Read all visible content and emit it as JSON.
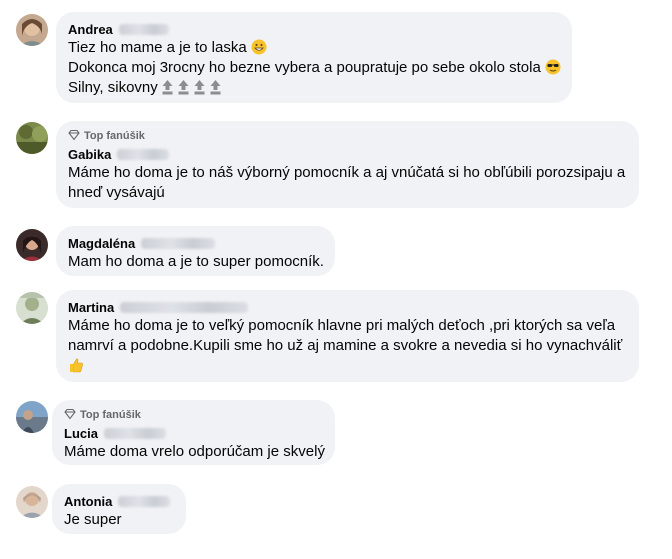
{
  "comments": [
    {
      "author": "Andrea",
      "badge": "",
      "lines": [
        "Tiez ho mame a je to laska",
        "Dokonca moj 3rocny ho bezne vybera a poupratuje po sebe okolo stola",
        "Silny, sikovny"
      ],
      "emojis": [
        "grinning-face-icon",
        "sunglasses-face-icon",
        "top-arrow-icon x4"
      ]
    },
    {
      "author": "Gabika",
      "badge": "Top fanúšik",
      "lines": [
        "Máme ho doma je to náš výborný pomocník a aj vnúčatá si ho obľúbili porozsipaju a",
        "hneď vysávajú"
      ]
    },
    {
      "author": "Magdaléna",
      "badge": "",
      "lines": [
        "Mam ho doma a je to super pomocník."
      ]
    },
    {
      "author": "Martina",
      "badge": "",
      "lines": [
        "Máme ho doma je to veľký pomocník hlavne pri malých deťoch ,pri ktorých sa veľa",
        "namrví a podobne.Kupili sme ho už aj mamine a svokre a nevedia si ho vynachváliť"
      ],
      "emojis": [
        "thumbs-up-icon"
      ]
    },
    {
      "author": "Lucia",
      "badge": "Top fanúšik",
      "lines": [
        "Máme doma vrelo odporúčam je skvelý"
      ]
    },
    {
      "author": "Antonia",
      "badge": "",
      "lines": [
        "Je super"
      ]
    }
  ],
  "colors": {
    "bubble": "#f0f2f5",
    "text": "#050505",
    "secondary": "#65676b",
    "emoji_yellow": "#f7c22a",
    "top_arrow_gray": "#8a8d91"
  }
}
